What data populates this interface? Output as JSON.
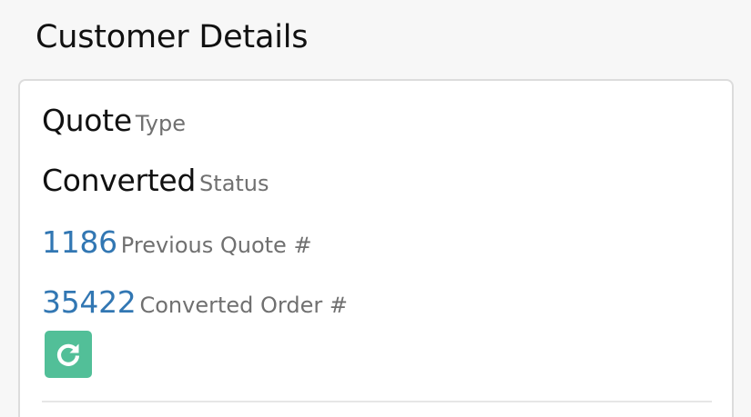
{
  "header": {
    "title": "Customer Details"
  },
  "details": {
    "type": {
      "value": "Quote",
      "label": "Type"
    },
    "status": {
      "value": "Converted",
      "label": "Status"
    },
    "previous_quote": {
      "value": "1186",
      "label": "Previous Quote #"
    },
    "converted_order": {
      "value": "35422",
      "label": "Converted Order #"
    }
  },
  "actions": {
    "refresh_icon": "refresh-icon"
  },
  "colors": {
    "link": "#3277b3",
    "refresh_button": "#52bf98",
    "caption": "#707070"
  }
}
